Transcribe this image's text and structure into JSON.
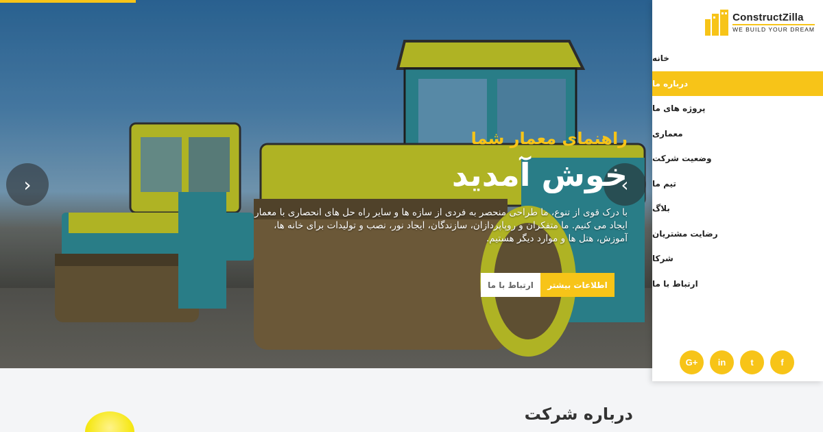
{
  "hero": {
    "subtitle": "راهنمای معمار شما",
    "title": "خوش آمدید",
    "description": "با درک قوی از تنوع، ما طراحی منحصر به فردی از سازه ها و سایر راه حل های انحصاری با معمار ایجاد می کنیم. ما متفکران و روپاپردازان، سازندگان، ایجاد نور، نصب و تولیدات برای خانه ها، آموزش، هتل ها و موارد دیگر هستیم.",
    "btn_more": "اطلاعات بیشتر",
    "btn_contact": "ارتباط با ما",
    "arrow_prev": "‹",
    "arrow_next": "›"
  },
  "logo": {
    "name": "ConstructZilla",
    "tagline": "WE BUILD YOUR DREAM"
  },
  "menu": [
    {
      "label": "خانه",
      "active": false
    },
    {
      "label": "درباره ما",
      "active": true
    },
    {
      "label": "پروژه های ما",
      "active": false
    },
    {
      "label": "معماری",
      "active": false
    },
    {
      "label": "وضعیت شرکت",
      "active": false
    },
    {
      "label": "تیم ما",
      "active": false
    },
    {
      "label": "بلاگ",
      "active": false
    },
    {
      "label": "رضایت مشتریان",
      "active": false
    },
    {
      "label": "شرکا",
      "active": false
    },
    {
      "label": "ارتباط با ما",
      "active": false
    }
  ],
  "socials": [
    {
      "icon": "google-plus-icon",
      "glyph": "G+"
    },
    {
      "icon": "linkedin-icon",
      "glyph": "in"
    },
    {
      "icon": "twitter-icon",
      "glyph": "t"
    },
    {
      "icon": "facebook-icon",
      "glyph": "f"
    }
  ],
  "about": {
    "title": "درباره شرکت"
  },
  "colors": {
    "accent": "#f7c418",
    "sidebar_bg": "#ffffff",
    "page_bg": "#f4f5f7"
  }
}
